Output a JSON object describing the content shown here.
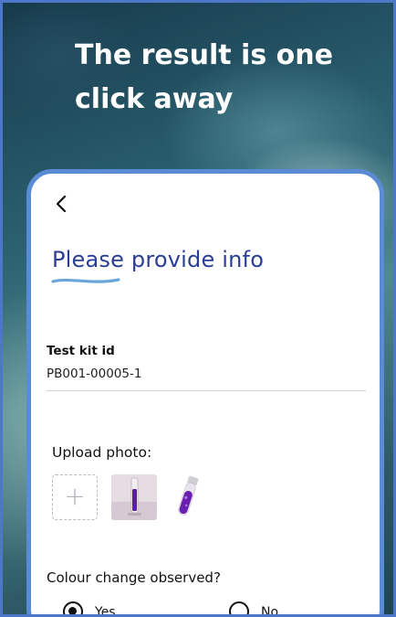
{
  "headline": "The result is one click away",
  "screen": {
    "back_icon": "chevron-left-icon",
    "title": "Please provide info",
    "test_kit": {
      "label": "Test kit id",
      "value": "PB001-00005-1"
    },
    "upload": {
      "label": "Upload photo:",
      "add_symbol": "+"
    },
    "colour_change": {
      "question": "Colour change observed?",
      "options": [
        {
          "label": "Yes",
          "selected": true
        },
        {
          "label": "No",
          "selected": false
        }
      ]
    }
  },
  "colors": {
    "title": "#2a3e94",
    "frame": "#5b8bd4",
    "swoosh": "#6aa6dc",
    "sample": "#5a1fa6"
  }
}
